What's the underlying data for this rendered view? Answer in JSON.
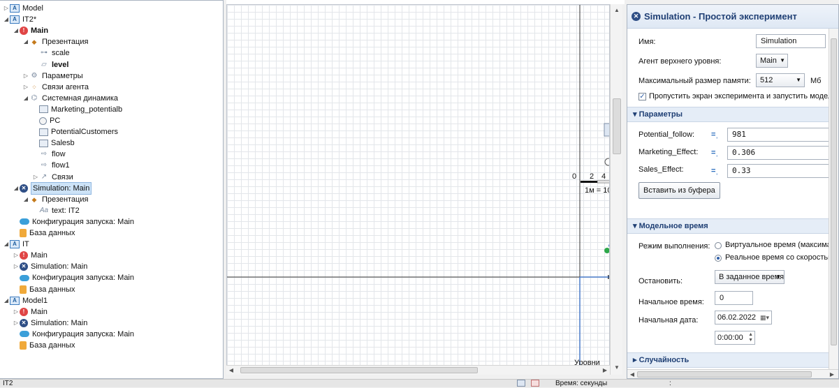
{
  "tree": [
    {
      "label": "Model",
      "icon": "model-icon",
      "arrow": "▷",
      "indent": 0,
      "bold": false
    },
    {
      "label": "IT2*",
      "icon": "model-icon",
      "arrow": "◢",
      "indent": 0,
      "bold": false
    },
    {
      "label": "Main",
      "icon": "agent-icon",
      "arrow": "◢",
      "indent": 1,
      "bold": true
    },
    {
      "label": "Презентация",
      "icon": "presentation-icon",
      "arrow": "◢",
      "indent": 2,
      "bold": false
    },
    {
      "label": "scale",
      "icon": "scale-icon",
      "arrow": "",
      "indent": 3,
      "bold": false
    },
    {
      "label": "level",
      "icon": "level-icon",
      "arrow": "",
      "indent": 3,
      "bold": true
    },
    {
      "label": "Параметры",
      "icon": "parameters-icon",
      "arrow": "▷",
      "indent": 2,
      "bold": false
    },
    {
      "label": "Связи агента",
      "icon": "agent-links-icon",
      "arrow": "▷",
      "indent": 2,
      "bold": false
    },
    {
      "label": "Системная динамика",
      "icon": "system-dynamics-icon",
      "arrow": "◢",
      "indent": 2,
      "bold": false
    },
    {
      "label": "Marketing_potentialb",
      "icon": "stock-icon",
      "arrow": "",
      "indent": 3,
      "bold": false
    },
    {
      "label": "PC",
      "icon": "variable-icon",
      "arrow": "",
      "indent": 3,
      "bold": false
    },
    {
      "label": "PotentialCustomers",
      "icon": "stock-icon",
      "arrow": "",
      "indent": 3,
      "bold": false
    },
    {
      "label": "Salesb",
      "icon": "stock-icon",
      "arrow": "",
      "indent": 3,
      "bold": false
    },
    {
      "label": "flow",
      "icon": "flow-icon",
      "arrow": "",
      "indent": 3,
      "bold": false
    },
    {
      "label": "flow1",
      "icon": "flow-icon",
      "arrow": "",
      "indent": 3,
      "bold": false
    },
    {
      "label": "Связи",
      "icon": "links-icon",
      "arrow": "▷",
      "indent": 3,
      "bold": false
    },
    {
      "label": "Simulation: Main",
      "icon": "simulation-icon",
      "arrow": "◢",
      "indent": 1,
      "bold": false,
      "selected": true
    },
    {
      "label": "Презентация",
      "icon": "presentation-icon",
      "arrow": "◢",
      "indent": 2,
      "bold": false
    },
    {
      "label": "text: IT2",
      "icon": "text-icon",
      "arrow": "",
      "indent": 3,
      "bold": false
    },
    {
      "label": "Конфигурация запуска: Main",
      "icon": "cloud-icon",
      "arrow": "",
      "indent": 1,
      "bold": false
    },
    {
      "label": "База данных",
      "icon": "database-icon",
      "arrow": "",
      "indent": 1,
      "bold": false
    },
    {
      "label": "IT",
      "icon": "model-icon",
      "arrow": "◢",
      "indent": 0,
      "bold": false
    },
    {
      "label": "Main",
      "icon": "agent-icon",
      "arrow": "▷",
      "indent": 1,
      "bold": false
    },
    {
      "label": "Simulation: Main",
      "icon": "simulation-icon",
      "arrow": "▷",
      "indent": 1,
      "bold": false
    },
    {
      "label": "Конфигурация запуска: Main",
      "icon": "cloud-icon",
      "arrow": "",
      "indent": 1,
      "bold": false
    },
    {
      "label": "База данных",
      "icon": "database-icon",
      "arrow": "",
      "indent": 1,
      "bold": false
    },
    {
      "label": "Model1",
      "icon": "model-icon",
      "arrow": "◢",
      "indent": 0,
      "bold": false
    },
    {
      "label": "Main",
      "icon": "agent-icon",
      "arrow": "▷",
      "indent": 1,
      "bold": false
    },
    {
      "label": "Simulation: Main",
      "icon": "simulation-icon",
      "arrow": "▷",
      "indent": 1,
      "bold": false
    },
    {
      "label": "Конфигурация запуска: Main",
      "icon": "cloud-icon",
      "arrow": "",
      "indent": 1,
      "bold": false
    },
    {
      "label": "База данных",
      "icon": "database-icon",
      "arrow": "",
      "indent": 1,
      "bold": false
    }
  ],
  "text_icon_glyph": "Aa",
  "canvas": {
    "ruler_zero": "0",
    "ruler_2": "2",
    "ruler_4": "4",
    "scale_label": "1м = 10",
    "levels_label": "Уровни"
  },
  "props": {
    "title": "Simulation - Простой эксперимент",
    "name_label": "Имя:",
    "name_value": "Simulation",
    "top_agent_label": "Агент верхнего уровня:",
    "top_agent_value": "Main",
    "memory_label": "Максимальный размер памяти:",
    "memory_value": "512",
    "memory_unit": "Мб",
    "skip_label": "Пропустить экран эксперимента и запустить модель",
    "skip_checked": true,
    "params_section": "Параметры",
    "params": [
      {
        "label": "Potential_follow:",
        "value": "981"
      },
      {
        "label": "Marketing_Effect:",
        "value": "0.306"
      },
      {
        "label": "Sales_Effect:",
        "value": "0.33"
      }
    ],
    "paste_button": "Вставить из буфера",
    "time_section": "Модельное время",
    "mode_label": "Режим выполнения:",
    "mode_virtual": "Виртуальное время (максимал",
    "mode_real": "Реальное время со скоростью",
    "stop_label": "Остановить:",
    "stop_value": "В заданное время",
    "start_time_label": "Начальное время:",
    "start_time_value": "0",
    "start_date_label": "Начальная дата:",
    "start_date_value": "06.02.2022",
    "start_clock_value": "0:00:00",
    "random_section": "Случайность"
  },
  "status": {
    "left_text": "IT2",
    "time_units": "Время: секунды",
    "separator": ":"
  },
  "colors": {
    "title": "#1f3f74",
    "selection": "#cde3f7",
    "agent": "#e04545",
    "simulation": "#2f4f86"
  }
}
